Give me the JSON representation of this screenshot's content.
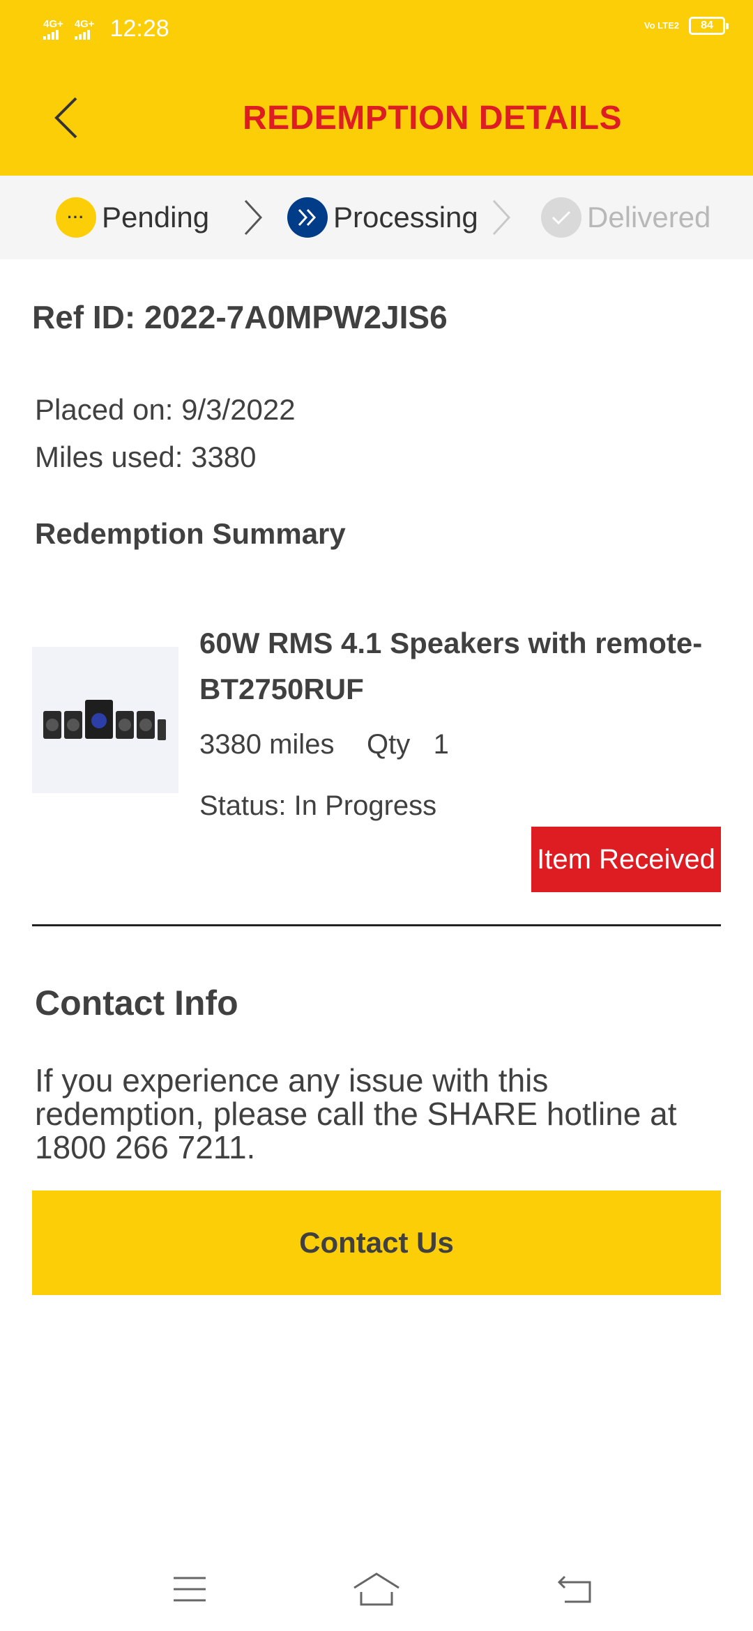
{
  "status_bar": {
    "net1": "4G+",
    "net2": "4G+",
    "time": "12:28",
    "volte": "Vo LTE2",
    "battery": "84"
  },
  "header": {
    "title": "REDEMPTION DETAILS",
    "back_icon": "chevron-left-icon"
  },
  "steps": [
    {
      "label": "Pending",
      "state": "done",
      "icon": "more-dots-icon"
    },
    {
      "label": "Processing",
      "state": "active",
      "icon": "double-chevron-icon"
    },
    {
      "label": "Delivered",
      "state": "inactive",
      "icon": "check-icon"
    }
  ],
  "order": {
    "ref": "Ref ID: 2022-7A0MPW2JIS6",
    "placed": "Placed on: 9/3/2022",
    "miles_used": "Miles used: 3380",
    "summary_heading": "Redemption Summary"
  },
  "item": {
    "name": "60W RMS 4.1 Speakers with remote-BT2750RUF",
    "miles": "3380 miles",
    "qty": "Qty   1",
    "status": "Status: In Progress",
    "received_label": "Item Received"
  },
  "contact": {
    "heading": "Contact Info",
    "text": "If you experience any issue with this redemption, please call the SHARE hotline at 1800 266 7211.",
    "button_label": "Contact Us"
  },
  "colors": {
    "brand_yellow": "#FBCE07",
    "brand_red": "#DD1D21",
    "processing_blue": "#003C88",
    "text": "#404040"
  }
}
